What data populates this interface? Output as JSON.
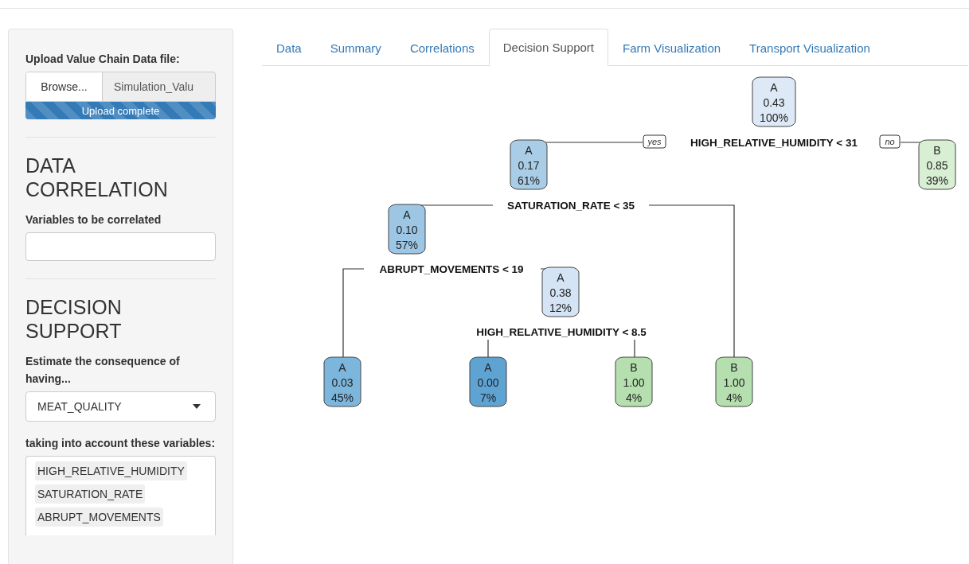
{
  "sidebar": {
    "upload": {
      "label": "Upload Value Chain Data file:",
      "button": "Browse...",
      "filename": "Simulation_Valu",
      "progress": {
        "text": "Upload complete",
        "level": 1
      }
    },
    "correlation": {
      "heading": "DATA CORRELATION",
      "label": "Variables to be correlated"
    },
    "decision": {
      "heading": "DECISION SUPPORT",
      "target_label": "Estimate the consequence of having...",
      "target_value": "MEAT_QUALITY",
      "variables_label": "taking into account these variables:",
      "variables": [
        "HIGH_RELATIVE_HUMIDITY",
        "SATURATION_RATE",
        "ABRUPT_MOVEMENTS"
      ]
    }
  },
  "tabs": [
    {
      "label": "Data",
      "selected": false
    },
    {
      "label": "Summary",
      "selected": false
    },
    {
      "label": "Correlations",
      "selected": false
    },
    {
      "label": "Decision Support",
      "selected": true
    },
    {
      "label": "Farm Visualization",
      "selected": false
    },
    {
      "label": "Transport Visualization",
      "selected": false
    }
  ],
  "tree": {
    "nodes": [
      {
        "class": "A",
        "probability": "0.43",
        "percent": "100%",
        "color": "#dde9f6"
      },
      {
        "class": "A",
        "probability": "0.17",
        "percent": "61%",
        "color": "#a9cde6"
      },
      {
        "class": "B",
        "probability": "0.85",
        "percent": "39%",
        "color": "#d8efd3"
      },
      {
        "class": "A",
        "probability": "0.10",
        "percent": "57%",
        "color": "#9cc6e4"
      },
      {
        "class": "A",
        "probability": "0.38",
        "percent": "12%",
        "color": "#d4e4f4"
      },
      {
        "class": "A",
        "probability": "0.03",
        "percent": "45%",
        "color": "#7db6dc"
      },
      {
        "class": "A",
        "probability": "0.00",
        "percent": "7%",
        "color": "#5fa3d3"
      },
      {
        "class": "B",
        "probability": "1.00",
        "percent": "4%",
        "color": "#b5dfae"
      },
      {
        "class": "B",
        "probability": "1.00",
        "percent": "4%",
        "color": "#b5dfae"
      }
    ],
    "splits": [
      "HIGH_RELATIVE_HUMIDITY < 31",
      "SATURATION_RATE < 35",
      "ABRUPT_MOVEMENTS < 19",
      "HIGH_RELATIVE_HUMIDITY < 8.5"
    ],
    "branch_labels": [
      "yes",
      "no"
    ]
  }
}
